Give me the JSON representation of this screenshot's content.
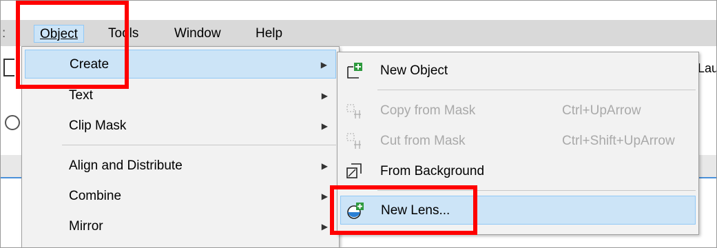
{
  "menubar": {
    "items": [
      {
        "label": "Object",
        "mnemonic_index": 0
      },
      {
        "label": "Tools",
        "mnemonic_index": 1
      },
      {
        "label": "Window",
        "mnemonic_index": 0
      },
      {
        "label": "Help",
        "mnemonic_index": 0
      }
    ]
  },
  "object_menu": {
    "items": [
      {
        "label": "Create",
        "highlighted": true,
        "has_submenu": true
      },
      {
        "label": "Text",
        "has_submenu": true
      },
      {
        "label": "Clip Mask",
        "has_submenu": true
      },
      {
        "label": "Align and Distribute",
        "has_submenu": true
      },
      {
        "label": "Combine",
        "has_submenu": true
      },
      {
        "label": "Mirror",
        "has_submenu": true
      }
    ]
  },
  "create_submenu": {
    "items": [
      {
        "label": "New Object",
        "icon": "new-object-icon",
        "enabled": true
      },
      {
        "label": "Copy from Mask",
        "shortcut": "Ctrl+UpArrow",
        "icon": "copy-from-mask-icon",
        "enabled": false
      },
      {
        "label": "Cut from Mask",
        "shortcut": "Ctrl+Shift+UpArrow",
        "icon": "cut-from-mask-icon",
        "enabled": false
      },
      {
        "label": "From Background",
        "icon": "from-background-icon",
        "enabled": true
      },
      {
        "label": "New Lens...",
        "icon": "new-lens-icon",
        "enabled": true,
        "highlighted": true
      }
    ]
  },
  "background": {
    "partial_text_right": "Lau"
  },
  "colors": {
    "highlight": "#cce4f7",
    "annotation": "#ff0000",
    "disabled_text": "#a9a9a9",
    "menubar": "#d9d9d9"
  }
}
